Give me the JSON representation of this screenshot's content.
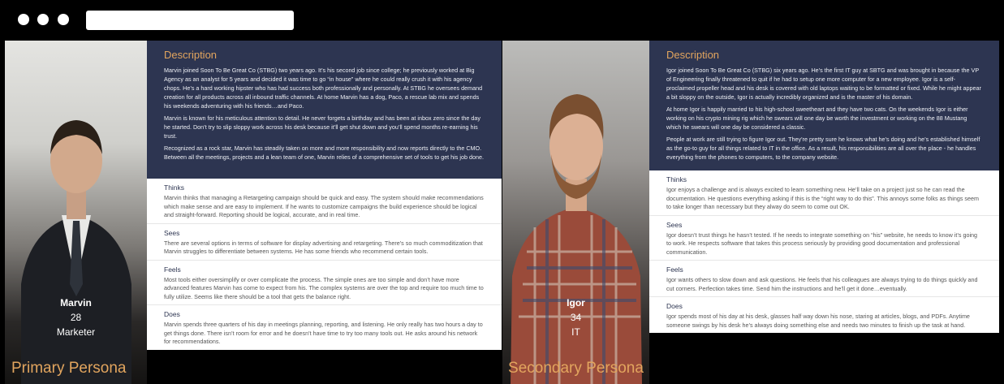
{
  "personas": [
    {
      "name": "Marvin",
      "age": "28",
      "role": "Marketer",
      "type_label": "Primary Persona",
      "description_title": "Description",
      "description": [
        "Marvin joined Soon To Be Great Co (STBG) two years ago. It’s his second job since college; he previously worked at Big Agency as an analyst for 5 years and decided it was time to go “in house” where he could really crush it with his agency chops. He’s a hard working hipster who has had success both professionally and personally. At STBG he oversees demand creation for all products across all inbound traffic channels. At home Marvin has a dog, Paco, a rescue lab mix and spends his weekends adventuring with his friends…and Paco.",
        "Marvin is known for his meticulous attention to detail. He never forgets a birthday and has been at inbox zero since the day he started. Don’t try to slip sloppy work across his desk because it’ll get shut down and you’ll spend months re-earning his trust.",
        "Recognized as a rock star, Marvin has steadily taken on more and more responsibility and now reports directly to the CMO. Between all the meetings, projects and a lean team of one, Marvin relies of a comprehensive set of tools to get his job done."
      ],
      "sections": [
        {
          "title": "Thinks",
          "text": "Marvin thinks that managing a Retargeting campaign should be quick and easy. The system should make recommendations which make sense and are easy to implement. If he wants to customize campaigns the build experience should be logical and straight-forward. Reporting should be logical, accurate, and in real time."
        },
        {
          "title": "Sees",
          "text": "There are several options in terms of software for display advertising and retargeting. There’s so much commoditization that Marvin struggles to differentiate between systems. He has some friends who recommend certain tools."
        },
        {
          "title": "Feels",
          "text": "Most tools either oversimplify or over complicate the process. The simple ones are too simple and don’t have more advanced features Marvin has come to expect from his. The complex systems are over the top and require too much time to fully utilize. Seems like there should be a tool that gets the balance right."
        },
        {
          "title": "Does",
          "text": "Marvin spends three quarters of his day in meetings planning, reporting, and listening. He only really has two hours a day to get things done. There isn’t room for error and he doesn’t have time to try too many tools out. He asks around his network for recommendations."
        }
      ]
    },
    {
      "name": "Igor",
      "age": "34",
      "role": "IT",
      "type_label": "Secondary Persona",
      "description_title": "Description",
      "description": [
        "Igor joined Soon To Be Great Co (STBG) six years ago. He’s the first IT guy at SBTG and was brought in because the VP of Engineering finally threatened to quit if he had to setup one more computer for a new employee. Igor is a self-proclaimed propeller head and his desk is covered with old laptops waiting to be formatted or fixed. While he might appear a bit sloppy on the outside, Igor is actually incredibly organized and is the master of his domain.",
        "At home Igor is happily married to his high-school sweetheart and they have two cats. On the weekends Igor is either working on his crypto mining rig which he swears will one day be worth the investment or working on the 88 Mustang which he swears will one day be considered a classic.",
        "People at work are still trying to figure Igor out. They’re pretty sure he knows what he’s doing and he’s established himself as the go-to guy for all things related to IT in the office. As a result, his responsibilities are all over the place - he handles everything from the phones to computers, to the company website."
      ],
      "sections": [
        {
          "title": "Thinks",
          "text": "Igor enjoys a challenge and is always excited to learn something new. He’ll take on a project just so he can read the documentation. He questions everything asking if this is the “right way to do this”. This annoys some folks as things seem to take longer than necessary but they alway do seem to come out OK."
        },
        {
          "title": "Sees",
          "text": "Igor doesn’t trust things he hasn’t tested. If he needs to integrate something on “his” website, he needs to know it’s going to work. He respects software that takes this process seriously by providing good documentation and professional communication."
        },
        {
          "title": "Feels",
          "text": "Igor wants others to slow down and ask questions. He feels that his colleagues are always trying to do things quickly and cut corners. Perfection takes time. Send him the instructions and he’ll get it done…eventually."
        },
        {
          "title": "Does",
          "text": "Igor spends most of his day at his desk, glasses half way down his nose, staring at articles, blogs, and PDFs. Anytime someone swings by his desk he’s always doing something else and needs two minutes to finish up the task at hand."
        }
      ]
    }
  ]
}
